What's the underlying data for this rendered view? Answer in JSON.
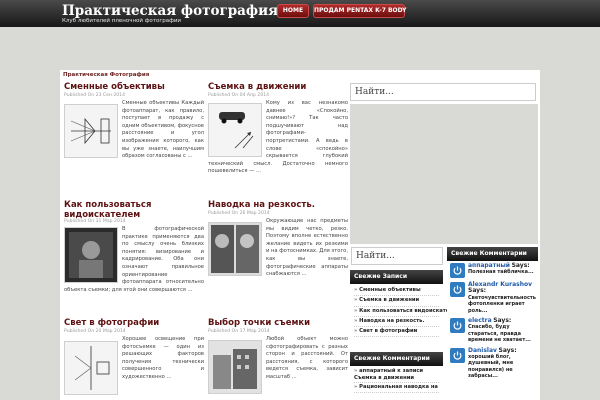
{
  "header": {
    "title": "Практическая фотография",
    "description": "Клуб любителей пленочной фотографии",
    "nav": [
      {
        "label": "HOME"
      },
      {
        "label": "ПРОДАМ PENTAX K-7 BODY"
      }
    ]
  },
  "breadcrumb": "Практическая Фотография",
  "posts": [
    {
      "title": "Сменные объективы",
      "meta": "Published On 23 Сен 2014",
      "excerpt": "Сменные объективы Каждый фотоаппарат, как правило, поступает в продажу с одним объективом, фокусное расстояние и угол изображения которого, как вы уже знаете, наилучшим образом согласованы с ...",
      "thumb_icon": "lens-diagram-icon"
    },
    {
      "title": "Съемка в движении",
      "meta": "Published On 04 Апр 2014",
      "excerpt": "Кому из вас незнакомо давнее «Спокойно, снимаю!»? Так часто подшучивают над фотографами-портретистами. А ведь в слове «спокойно» скрывается глубокий технический смысл. Достаточно немного пошевелиться — ...",
      "thumb_icon": "car-motion-icon"
    },
    {
      "title": "Как пользоваться видоискателем",
      "meta": "Published On 31 Мар 2014",
      "excerpt": "В фотографической практике применяются два по смыслу очень близких понятия: визирование и кадрирование. Оба они означают правильное ориентирование фотоаппарата относительно объекта съемки; для этой они совершаются ...",
      "thumb_icon": "portrait-photo-icon"
    },
    {
      "title": "Наводка на резкость.",
      "meta": "Published On 26 Мар 2014",
      "excerpt": "Окружающие нас предметы мы видим четко, резко. Поэтому вполне естественно желание видеть их резкими и на фотоснимках. Для этого, как вы знаете, фотографические аппараты снабжаются ...",
      "thumb_icon": "two-portraits-icon"
    },
    {
      "title": "Свет в фотографии",
      "meta": "Published On 20 Мар 2014",
      "excerpt": "Хорошее освещение при фотосъемке — один из решающих факторов получения технически совершенного и художественно ...",
      "thumb_icon": "light-diagram-icon"
    },
    {
      "title": "Выбор точки съемки",
      "meta": "Published On 17 Мар 2014",
      "excerpt": "Любой объект можно сфотографировать с разных сторон и расстояний. От расстояния, с которого ведется съемка, зависит масштаб ...",
      "thumb_icon": "buildings-photo-icon"
    }
  ],
  "sidebar": {
    "search_top": "Найти...",
    "search_small": "Найти...",
    "recent_posts_title": "Свежие Записи",
    "recent_posts": [
      "Сменные объективы",
      "Съемка в движении",
      "Как пользоваться видоискателем",
      "Наводка на резкость.",
      "Свет в фотографии"
    ],
    "recent_comments_title": "Свежие Комментарии",
    "recent_comments_list": [
      "аппаратный к записи Съемка в движении",
      "Рациональная наводка на"
    ],
    "comments_title": "Свежие Комментарии",
    "says_label": "Says:",
    "comments": [
      {
        "author": "аппаратный",
        "excerpt": "Полезная тайбличка..."
      },
      {
        "author": "Alexandr Kurashov",
        "excerpt": "Светочувствительность фотопленки играет роль..."
      },
      {
        "author": "electra",
        "excerpt": "Спасибо, буду стараться, правда времени не хватает..."
      },
      {
        "author": "Danislav",
        "excerpt": "хороший блог, душевный, мне понравился) не забрасы..."
      }
    ]
  },
  "colors": {
    "title_red": "#5e1313",
    "nav_red": "#9b1f1f",
    "link_blue": "#1e5aa8"
  }
}
